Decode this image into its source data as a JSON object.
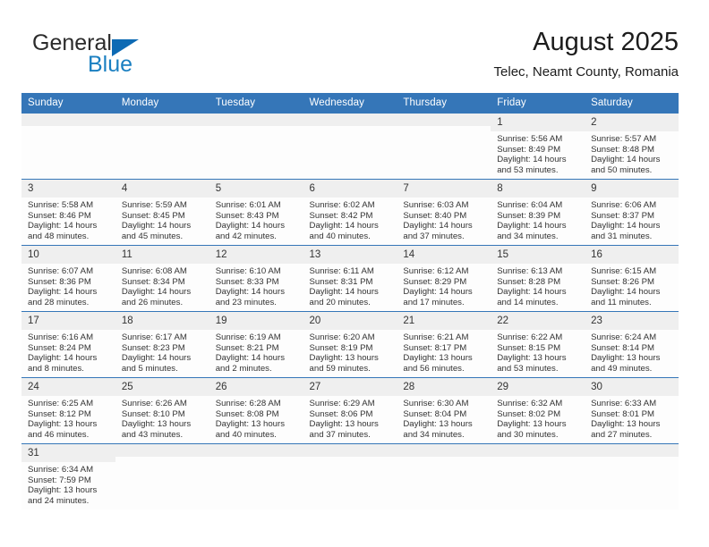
{
  "brand": {
    "line1": "General",
    "line2": "Blue",
    "triangle_color": "#0d6ab4",
    "blue_color": "#1a7fc1"
  },
  "header": {
    "title": "August 2025",
    "subtitle": "Telec, Neamt County, Romania"
  },
  "theme": {
    "header_blue": "#3576b8",
    "daynum_bg": "#efefef",
    "cell_bg": "#fdfdfd"
  },
  "weekdays": [
    "Sunday",
    "Monday",
    "Tuesday",
    "Wednesday",
    "Thursday",
    "Friday",
    "Saturday"
  ],
  "labels": {
    "sunrise_prefix": "Sunrise: ",
    "sunset_prefix": "Sunset: ",
    "daylight_prefix": "Daylight: "
  },
  "weeks": [
    [
      {
        "day": "",
        "empty": true
      },
      {
        "day": "",
        "empty": true
      },
      {
        "day": "",
        "empty": true
      },
      {
        "day": "",
        "empty": true
      },
      {
        "day": "",
        "empty": true
      },
      {
        "day": "1",
        "sunrise": "Sunrise: 5:56 AM",
        "sunset": "Sunset: 8:49 PM",
        "daylight_1": "Daylight: 14 hours",
        "daylight_2": "and 53 minutes."
      },
      {
        "day": "2",
        "sunrise": "Sunrise: 5:57 AM",
        "sunset": "Sunset: 8:48 PM",
        "daylight_1": "Daylight: 14 hours",
        "daylight_2": "and 50 minutes."
      }
    ],
    [
      {
        "day": "3",
        "sunrise": "Sunrise: 5:58 AM",
        "sunset": "Sunset: 8:46 PM",
        "daylight_1": "Daylight: 14 hours",
        "daylight_2": "and 48 minutes."
      },
      {
        "day": "4",
        "sunrise": "Sunrise: 5:59 AM",
        "sunset": "Sunset: 8:45 PM",
        "daylight_1": "Daylight: 14 hours",
        "daylight_2": "and 45 minutes."
      },
      {
        "day": "5",
        "sunrise": "Sunrise: 6:01 AM",
        "sunset": "Sunset: 8:43 PM",
        "daylight_1": "Daylight: 14 hours",
        "daylight_2": "and 42 minutes."
      },
      {
        "day": "6",
        "sunrise": "Sunrise: 6:02 AM",
        "sunset": "Sunset: 8:42 PM",
        "daylight_1": "Daylight: 14 hours",
        "daylight_2": "and 40 minutes."
      },
      {
        "day": "7",
        "sunrise": "Sunrise: 6:03 AM",
        "sunset": "Sunset: 8:40 PM",
        "daylight_1": "Daylight: 14 hours",
        "daylight_2": "and 37 minutes."
      },
      {
        "day": "8",
        "sunrise": "Sunrise: 6:04 AM",
        "sunset": "Sunset: 8:39 PM",
        "daylight_1": "Daylight: 14 hours",
        "daylight_2": "and 34 minutes."
      },
      {
        "day": "9",
        "sunrise": "Sunrise: 6:06 AM",
        "sunset": "Sunset: 8:37 PM",
        "daylight_1": "Daylight: 14 hours",
        "daylight_2": "and 31 minutes."
      }
    ],
    [
      {
        "day": "10",
        "sunrise": "Sunrise: 6:07 AM",
        "sunset": "Sunset: 8:36 PM",
        "daylight_1": "Daylight: 14 hours",
        "daylight_2": "and 28 minutes."
      },
      {
        "day": "11",
        "sunrise": "Sunrise: 6:08 AM",
        "sunset": "Sunset: 8:34 PM",
        "daylight_1": "Daylight: 14 hours",
        "daylight_2": "and 26 minutes."
      },
      {
        "day": "12",
        "sunrise": "Sunrise: 6:10 AM",
        "sunset": "Sunset: 8:33 PM",
        "daylight_1": "Daylight: 14 hours",
        "daylight_2": "and 23 minutes."
      },
      {
        "day": "13",
        "sunrise": "Sunrise: 6:11 AM",
        "sunset": "Sunset: 8:31 PM",
        "daylight_1": "Daylight: 14 hours",
        "daylight_2": "and 20 minutes."
      },
      {
        "day": "14",
        "sunrise": "Sunrise: 6:12 AM",
        "sunset": "Sunset: 8:29 PM",
        "daylight_1": "Daylight: 14 hours",
        "daylight_2": "and 17 minutes."
      },
      {
        "day": "15",
        "sunrise": "Sunrise: 6:13 AM",
        "sunset": "Sunset: 8:28 PM",
        "daylight_1": "Daylight: 14 hours",
        "daylight_2": "and 14 minutes."
      },
      {
        "day": "16",
        "sunrise": "Sunrise: 6:15 AM",
        "sunset": "Sunset: 8:26 PM",
        "daylight_1": "Daylight: 14 hours",
        "daylight_2": "and 11 minutes."
      }
    ],
    [
      {
        "day": "17",
        "sunrise": "Sunrise: 6:16 AM",
        "sunset": "Sunset: 8:24 PM",
        "daylight_1": "Daylight: 14 hours",
        "daylight_2": "and 8 minutes."
      },
      {
        "day": "18",
        "sunrise": "Sunrise: 6:17 AM",
        "sunset": "Sunset: 8:23 PM",
        "daylight_1": "Daylight: 14 hours",
        "daylight_2": "and 5 minutes."
      },
      {
        "day": "19",
        "sunrise": "Sunrise: 6:19 AM",
        "sunset": "Sunset: 8:21 PM",
        "daylight_1": "Daylight: 14 hours",
        "daylight_2": "and 2 minutes."
      },
      {
        "day": "20",
        "sunrise": "Sunrise: 6:20 AM",
        "sunset": "Sunset: 8:19 PM",
        "daylight_1": "Daylight: 13 hours",
        "daylight_2": "and 59 minutes."
      },
      {
        "day": "21",
        "sunrise": "Sunrise: 6:21 AM",
        "sunset": "Sunset: 8:17 PM",
        "daylight_1": "Daylight: 13 hours",
        "daylight_2": "and 56 minutes."
      },
      {
        "day": "22",
        "sunrise": "Sunrise: 6:22 AM",
        "sunset": "Sunset: 8:15 PM",
        "daylight_1": "Daylight: 13 hours",
        "daylight_2": "and 53 minutes."
      },
      {
        "day": "23",
        "sunrise": "Sunrise: 6:24 AM",
        "sunset": "Sunset: 8:14 PM",
        "daylight_1": "Daylight: 13 hours",
        "daylight_2": "and 49 minutes."
      }
    ],
    [
      {
        "day": "24",
        "sunrise": "Sunrise: 6:25 AM",
        "sunset": "Sunset: 8:12 PM",
        "daylight_1": "Daylight: 13 hours",
        "daylight_2": "and 46 minutes."
      },
      {
        "day": "25",
        "sunrise": "Sunrise: 6:26 AM",
        "sunset": "Sunset: 8:10 PM",
        "daylight_1": "Daylight: 13 hours",
        "daylight_2": "and 43 minutes."
      },
      {
        "day": "26",
        "sunrise": "Sunrise: 6:28 AM",
        "sunset": "Sunset: 8:08 PM",
        "daylight_1": "Daylight: 13 hours",
        "daylight_2": "and 40 minutes."
      },
      {
        "day": "27",
        "sunrise": "Sunrise: 6:29 AM",
        "sunset": "Sunset: 8:06 PM",
        "daylight_1": "Daylight: 13 hours",
        "daylight_2": "and 37 minutes."
      },
      {
        "day": "28",
        "sunrise": "Sunrise: 6:30 AM",
        "sunset": "Sunset: 8:04 PM",
        "daylight_1": "Daylight: 13 hours",
        "daylight_2": "and 34 minutes."
      },
      {
        "day": "29",
        "sunrise": "Sunrise: 6:32 AM",
        "sunset": "Sunset: 8:02 PM",
        "daylight_1": "Daylight: 13 hours",
        "daylight_2": "and 30 minutes."
      },
      {
        "day": "30",
        "sunrise": "Sunrise: 6:33 AM",
        "sunset": "Sunset: 8:01 PM",
        "daylight_1": "Daylight: 13 hours",
        "daylight_2": "and 27 minutes."
      }
    ],
    [
      {
        "day": "31",
        "sunrise": "Sunrise: 6:34 AM",
        "sunset": "Sunset: 7:59 PM",
        "daylight_1": "Daylight: 13 hours",
        "daylight_2": "and 24 minutes."
      },
      {
        "day": "",
        "empty": true
      },
      {
        "day": "",
        "empty": true
      },
      {
        "day": "",
        "empty": true
      },
      {
        "day": "",
        "empty": true
      },
      {
        "day": "",
        "empty": true
      },
      {
        "day": "",
        "empty": true
      }
    ]
  ]
}
